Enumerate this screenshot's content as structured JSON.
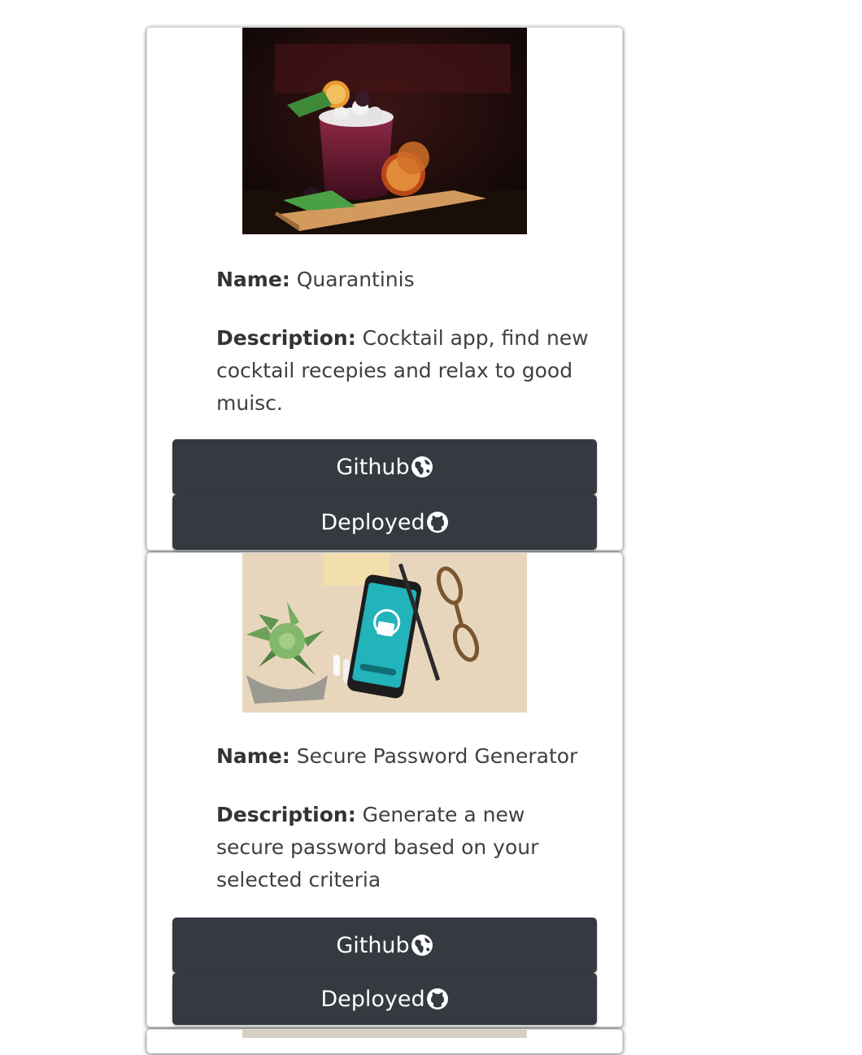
{
  "labels": {
    "name": "Name:",
    "description": "Description:"
  },
  "projects": [
    {
      "image_alt": "cocktail-image",
      "name": "Quarantinis",
      "description": "Cocktail app, find new cocktail recepies and relax to good muisc.",
      "github_label": "Github",
      "deployed_label": "Deployed"
    },
    {
      "image_alt": "password-phone-image",
      "name": "Secure Password Generator",
      "description": "Generate a new secure password based on your selected criteria",
      "github_label": "Github",
      "deployed_label": "Deployed"
    }
  ],
  "icons": {
    "github_button_icon": "globe-icon",
    "deployed_button_icon": "github-icon"
  },
  "colors": {
    "button_bg": "#343a40",
    "button_text": "#ffffff",
    "page_bg": "#ffffff"
  }
}
